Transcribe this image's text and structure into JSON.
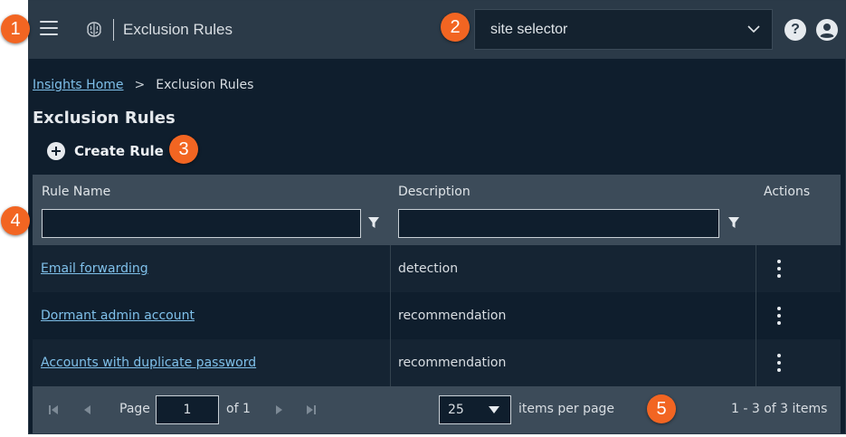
{
  "header": {
    "title": "Exclusion Rules",
    "site_selector_label": "site selector"
  },
  "breadcrumb": {
    "home": "Insights Home",
    "separator": ">",
    "current": "Exclusion Rules"
  },
  "page": {
    "title": "Exclusion Rules",
    "create_label": "Create Rule"
  },
  "grid": {
    "columns": [
      "Rule Name",
      "Description",
      "Actions"
    ],
    "rows": [
      {
        "name": "Email forwarding",
        "description": "detection"
      },
      {
        "name": "Dormant admin account",
        "description": "recommendation"
      },
      {
        "name": "Accounts with duplicate password",
        "description": "recommendation"
      }
    ]
  },
  "pager": {
    "page_label": "Page",
    "page_value": "1",
    "of_label": "of 1",
    "page_size": "25",
    "per_page_label": "items per page",
    "summary": "1 - 3 of 3 items"
  },
  "callouts": [
    "1",
    "2",
    "3",
    "4",
    "5"
  ],
  "colors": {
    "background": "#0f1e2d",
    "header_bar": "#2b3a48",
    "grid_header": "#3c4b59",
    "link": "#7fc0ea",
    "callout": "#f26522"
  }
}
